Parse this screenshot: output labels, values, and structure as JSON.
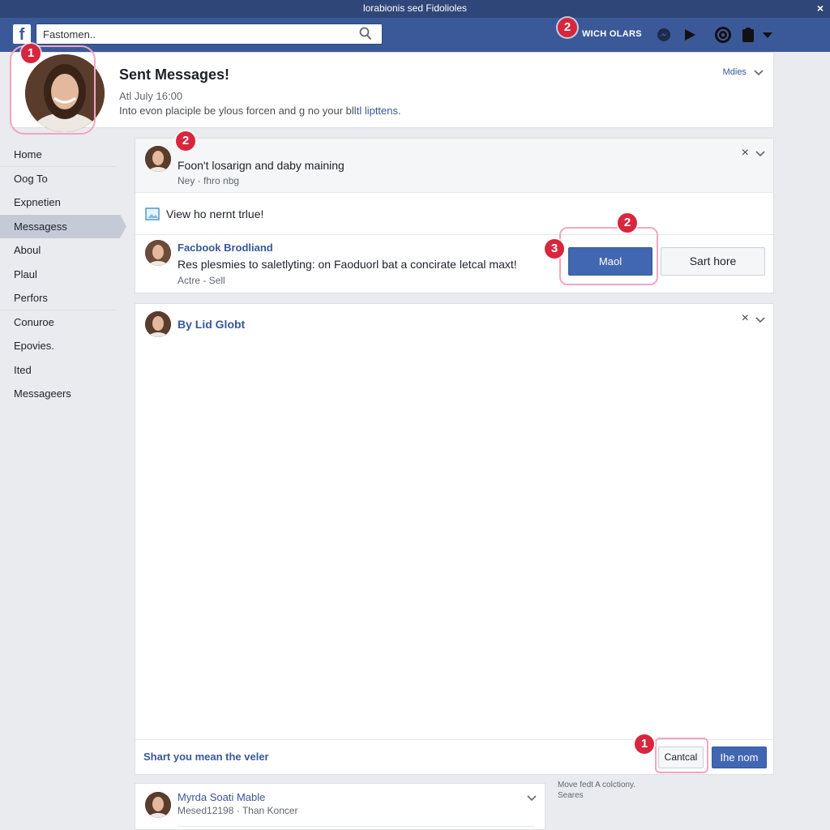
{
  "window": {
    "title": "lorabionis sed Fidolioles",
    "close_label": "×"
  },
  "topnav": {
    "logo": "f",
    "search_value": "Fastomen..",
    "link_label": "WICH OLARS",
    "icons": [
      "messenger-icon",
      "play-icon",
      "globe-icon",
      "clipboard-icon",
      "caret-down-icon"
    ]
  },
  "profile": {
    "title": "Sent Messages!",
    "date": "Atl July 16:00",
    "description": "Into evon placiple be ylous forcen and g no your bll",
    "description_link": "tl lipttens.",
    "menu_label": "Mdies"
  },
  "sidebar": {
    "items": [
      {
        "label": "Home"
      },
      {
        "label": "Oog To"
      },
      {
        "label": "Expnetien"
      },
      {
        "label": "Messagess"
      },
      {
        "label": "Aboul"
      },
      {
        "label": "Plaul"
      },
      {
        "label": "Perfors"
      },
      {
        "label": "Conuroe"
      },
      {
        "label": "Epovies."
      },
      {
        "label": "Ited"
      },
      {
        "label": "Messageers"
      }
    ]
  },
  "panel1": {
    "header_title": "Foon't losarign and daby maining",
    "header_meta": "Ney · fhro nbg",
    "notice": "View ho nernt trlue!",
    "msg_sender": "Facbook Brodliand",
    "msg_text": "Res plesmies to saletlyting: on Faoduorl bat a concirate letcal maxt!",
    "msg_meta": "Actre - Sell",
    "primary_button": "Maol",
    "secondary_button": "Sart hore",
    "close_label": "×"
  },
  "panel2": {
    "title": "By Lid Globt",
    "footer_text": "Shart you mean the veler",
    "cancel_button": "Cantcal",
    "submit_button": "Ihe nom",
    "close_label": "×"
  },
  "panel3": {
    "name": "Myrda Soati Mable",
    "meta": "Mesed12198 · Than Koncer"
  },
  "side_note": {
    "line1": "Move fedt A colctiony.",
    "line2": "Seares"
  },
  "annotations": [
    "1",
    "2",
    "2",
    "2",
    "3",
    "1"
  ],
  "colors": {
    "brand": "#3b5998",
    "titlebar": "#2f4679",
    "badge": "#d7263d",
    "highlight": "#f2a6c0",
    "link": "#385898"
  }
}
